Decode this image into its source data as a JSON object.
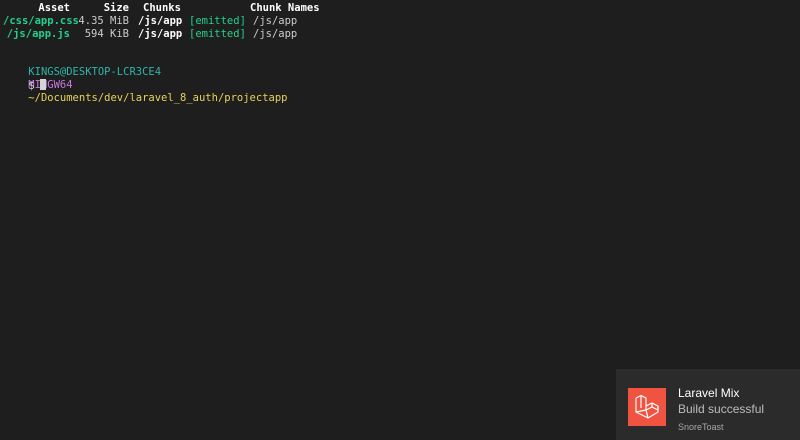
{
  "terminal": {
    "headers": {
      "asset": "Asset",
      "size": "Size",
      "chunks": "Chunks",
      "chunk_names": "Chunk Names"
    },
    "rows": [
      {
        "asset": "/css/app.css",
        "size": "4.35 MiB",
        "chunks": "/js/app",
        "status": "[emitted]",
        "chunk_name": "/js/app"
      },
      {
        "asset": "/js/app.js",
        "size": "594 KiB",
        "chunks": "/js/app",
        "status": "[emitted]",
        "chunk_name": "/js/app"
      }
    ],
    "prompt": {
      "user_host": "KINGS@DESKTOP-LCR3CE4",
      "shell": "MINGW64",
      "path": "~/Documents/dev/laravel_8_auth/projectapp",
      "symbol": "$"
    }
  },
  "toast": {
    "title": "Laravel Mix",
    "body": "Build successful",
    "attribution": "SnoreToast",
    "icon": "laravel-logo-icon",
    "icon_color": "#f05340"
  }
}
